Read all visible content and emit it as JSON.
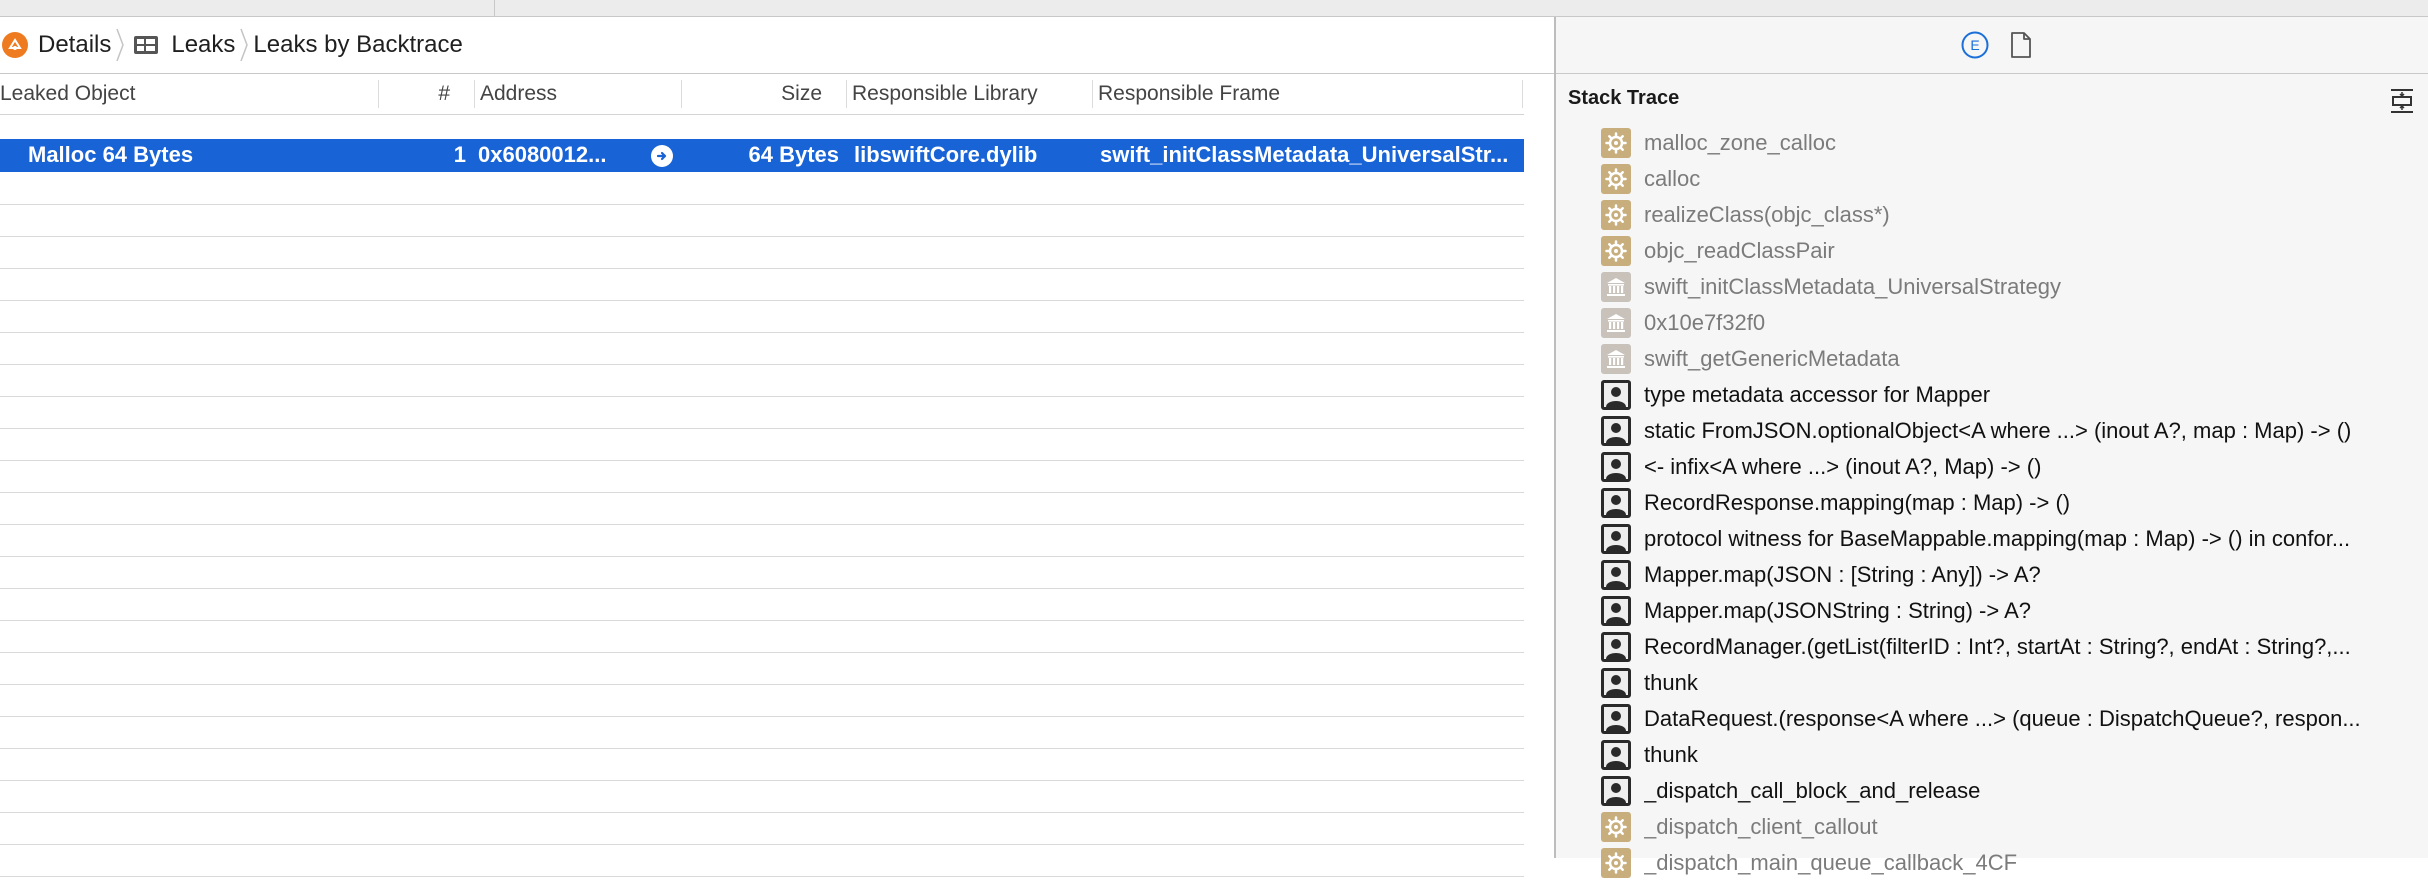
{
  "breadcrumb": {
    "items": [
      {
        "label": "Details"
      },
      {
        "label": "Leaks"
      },
      {
        "label": "Leaks by Backtrace"
      }
    ]
  },
  "table": {
    "columns": {
      "leaked_object": "Leaked Object",
      "count": "#",
      "address": "Address",
      "size": "Size",
      "library": "Responsible Library",
      "frame": "Responsible Frame"
    },
    "selected_row": {
      "leaked_object": "Malloc 64 Bytes",
      "count": "1",
      "address": "0x6080012...",
      "size": "64 Bytes",
      "library": "libswiftCore.dylib",
      "frame": "swift_initClassMetadata_UniversalStr..."
    }
  },
  "inspector": {
    "extended_icon_letter": "E",
    "stack_trace_title": "Stack Trace",
    "frames": [
      {
        "label": "malloc_zone_calloc",
        "kind": "system"
      },
      {
        "label": "calloc",
        "kind": "system"
      },
      {
        "label": "realizeClass(objc_class*)",
        "kind": "system"
      },
      {
        "label": "objc_readClassPair",
        "kind": "system"
      },
      {
        "label": "swift_initClassMetadata_UniversalStrategy",
        "kind": "library"
      },
      {
        "label": "0x10e7f32f0",
        "kind": "library"
      },
      {
        "label": "swift_getGenericMetadata",
        "kind": "library"
      },
      {
        "label": "type metadata accessor for Mapper",
        "kind": "user"
      },
      {
        "label": "static FromJSON.optionalObject<A where ...> (inout A?, map : Map) -> ()",
        "kind": "user"
      },
      {
        "label": "<- infix<A where ...> (inout A?, Map) -> ()",
        "kind": "user"
      },
      {
        "label": "RecordResponse.mapping(map : Map) -> ()",
        "kind": "user"
      },
      {
        "label": "protocol witness for BaseMappable.mapping(map : Map) -> () in confor...",
        "kind": "user"
      },
      {
        "label": "Mapper.map(JSON : [String : Any]) -> A?",
        "kind": "user"
      },
      {
        "label": "Mapper.map(JSONString : String) -> A?",
        "kind": "user"
      },
      {
        "label": "RecordManager.(getList(filterID : Int?, startAt : String?, endAt : String?,...",
        "kind": "user"
      },
      {
        "label": "thunk",
        "kind": "user"
      },
      {
        "label": "DataRequest.(response<A where ...> (queue : DispatchQueue?, respon...",
        "kind": "user"
      },
      {
        "label": "thunk",
        "kind": "user"
      },
      {
        "label": "_dispatch_call_block_and_release",
        "kind": "user"
      },
      {
        "label": "_dispatch_client_callout",
        "kind": "system"
      },
      {
        "label": "_dispatch_main_queue_callback_4CF",
        "kind": "system"
      }
    ]
  },
  "colors": {
    "selection": "#1863d6",
    "app_icon": "#ee7b20",
    "inspector_accent": "#1a6fd8",
    "system_frame_icon": "#c8ae7c",
    "library_frame_icon": "#c8c2bb",
    "user_frame_icon": "#2a2a2a"
  }
}
